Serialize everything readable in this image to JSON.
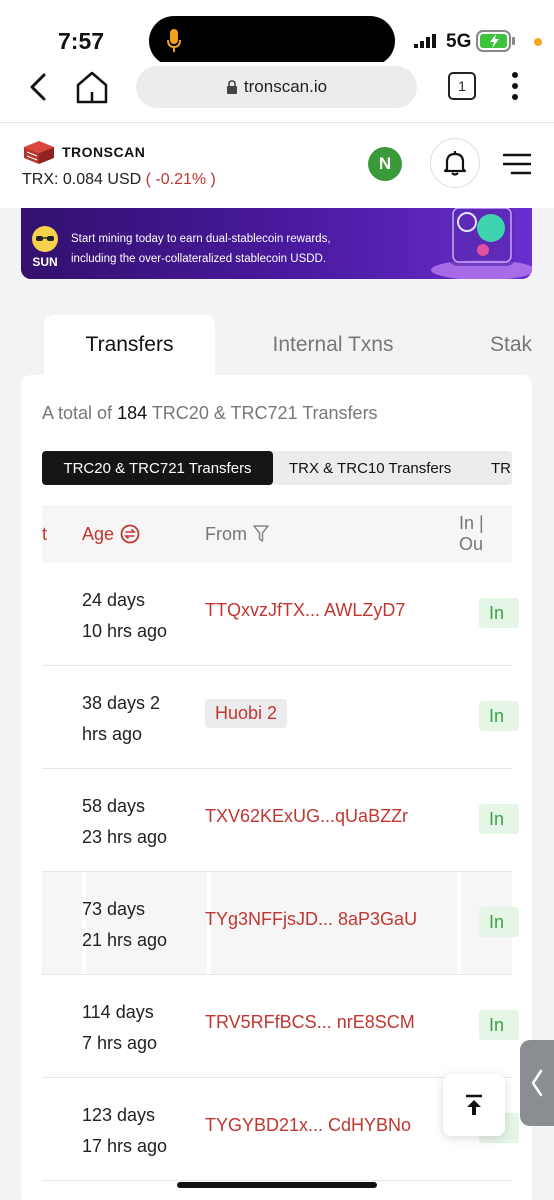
{
  "status_bar": {
    "time": "7:57",
    "network": "5G",
    "icons": [
      "microphone-icon",
      "signal-icon",
      "battery-charging-icon"
    ]
  },
  "browser": {
    "url": "tronscan.io",
    "tab_count": "1",
    "icons": [
      "back-icon",
      "home-icon",
      "lock-icon",
      "more-icon"
    ]
  },
  "header": {
    "logo_text": "TRONSCAN",
    "price_prefix": "TRX:",
    "price_value": "0.084 USD",
    "price_change": "( -0.21% )",
    "avatar_letter": "N",
    "icons": [
      "bell-icon",
      "menu-icon"
    ],
    "colors": {
      "price_change": "#c23631",
      "avatar": "#3a9a3a"
    }
  },
  "banner": {
    "brand": "SUN",
    "line1": "Start mining today to earn dual-stablecoin rewards,",
    "line2": "including the over-collateralized stablecoin USDD."
  },
  "tabs": [
    {
      "label": "Transfers",
      "active": true
    },
    {
      "label": "Internal Txns",
      "active": false
    },
    {
      "label": "Stak",
      "active": false
    }
  ],
  "summary": {
    "prefix": "A total of",
    "count": "184",
    "suffix": "TRC20 & TRC721 Transfers"
  },
  "filters": [
    {
      "label": "TRC20 & TRC721 Transfers",
      "active": true
    },
    {
      "label": "TRX & TRC10 Transfers",
      "active": false
    },
    {
      "label": "TR",
      "active": false
    }
  ],
  "table": {
    "columns": {
      "cut": "t",
      "age": "Age",
      "from": "From",
      "in_out": "In | Ou"
    },
    "rows": [
      {
        "age_line1": "24 days",
        "age_line2": "10 hrs ago",
        "from": "TTQxvzJfTX... AWLZyD7",
        "tag": false,
        "direction": "In"
      },
      {
        "age_line1": "38 days 2",
        "age_line2": "hrs ago",
        "from": "Huobi 2",
        "tag": true,
        "direction": "In"
      },
      {
        "age_line1": "58 days",
        "age_line2": "23 hrs ago",
        "from": "TXV62KExUG...qUaBZZr",
        "tag": false,
        "direction": "In"
      },
      {
        "age_line1": "73 days",
        "age_line2": "21 hrs ago",
        "from": "TYg3NFFjsJD... 8aP3GaU",
        "tag": false,
        "direction": "In"
      },
      {
        "age_line1": "114 days",
        "age_line2": "7 hrs ago",
        "from": "TRV5RFfBCS... nrE8SCM",
        "tag": false,
        "direction": "In"
      },
      {
        "age_line1": "123 days",
        "age_line2": "17 hrs ago",
        "from": "TYGYBD21x... CdHYBNo",
        "tag": false,
        "direction": "In"
      }
    ]
  },
  "floating": {
    "icons": [
      "scroll-to-top-icon",
      "chevron-left-icon"
    ]
  }
}
